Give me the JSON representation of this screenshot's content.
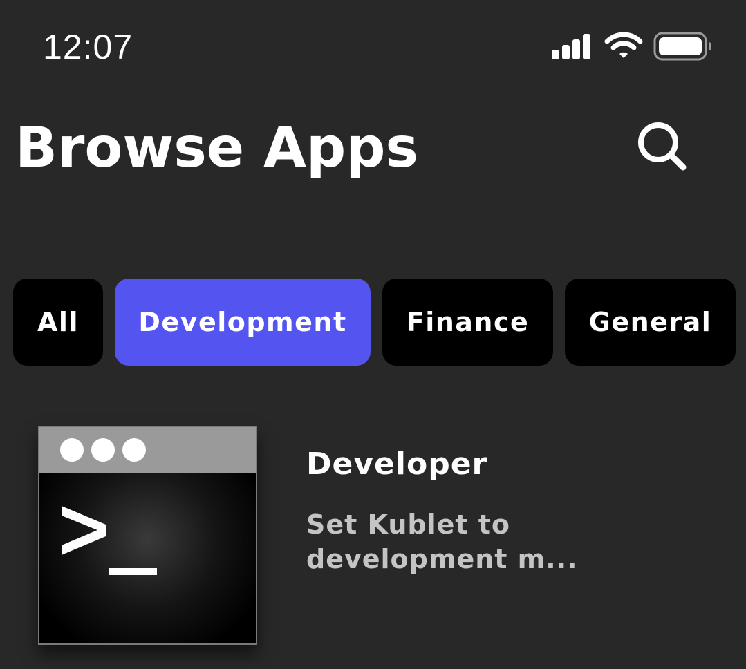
{
  "status_bar": {
    "time": "12:07",
    "signal_icon": "cellular-signal-icon",
    "wifi_icon": "wifi-icon",
    "battery_icon": "battery-icon"
  },
  "header": {
    "title": "Browse Apps",
    "search_icon": "search-icon"
  },
  "tabs": [
    {
      "label": "All",
      "active": false
    },
    {
      "label": "Development",
      "active": true
    },
    {
      "label": "Finance",
      "active": false
    },
    {
      "label": "General",
      "active": false
    }
  ],
  "apps": [
    {
      "name": "Developer",
      "description": "Set Kublet to development m...",
      "icon": "terminal-icon"
    }
  ],
  "colors": {
    "background": "#282828",
    "tab_inactive": "#000000",
    "tab_active": "#5454f0",
    "description_text": "#c4c4c4"
  }
}
